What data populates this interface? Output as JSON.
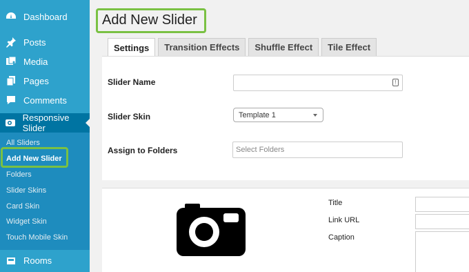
{
  "sidebar": {
    "items": [
      {
        "label": "Dashboard",
        "icon": "dashboard-icon"
      },
      {
        "label": "Posts",
        "icon": "pin-icon"
      },
      {
        "label": "Media",
        "icon": "media-icon"
      },
      {
        "label": "Pages",
        "icon": "pages-icon"
      },
      {
        "label": "Comments",
        "icon": "comment-icon"
      },
      {
        "label": "Responsive Slider",
        "icon": "camera-icon"
      }
    ],
    "submenu": [
      "All Sliders",
      "Add New Slider",
      "Folders",
      "Slider Skins",
      "Card Skin",
      "Widget Skin",
      "Touch Mobile Skin"
    ],
    "after": {
      "label": "Rooms",
      "icon": "rooms-icon"
    }
  },
  "main": {
    "title": "Add New Slider",
    "tabs": [
      "Settings",
      "Transition Effects",
      "Shuffle Effect",
      "Tile Effect"
    ],
    "form": {
      "slider_name_label": "Slider Name",
      "slider_skin_label": "Slider Skin",
      "slider_skin_value": "Template 1",
      "assign_label": "Assign to Folders",
      "assign_placeholder": "Select Folders"
    },
    "slide": {
      "title_label": "Title",
      "link_label": "Link URL",
      "caption_label": "Caption"
    }
  },
  "colors": {
    "sidebar": "#2ea2cc",
    "sidebar_current": "#0074a2",
    "submenu": "#1e8cbe",
    "highlight": "#7ac143"
  }
}
